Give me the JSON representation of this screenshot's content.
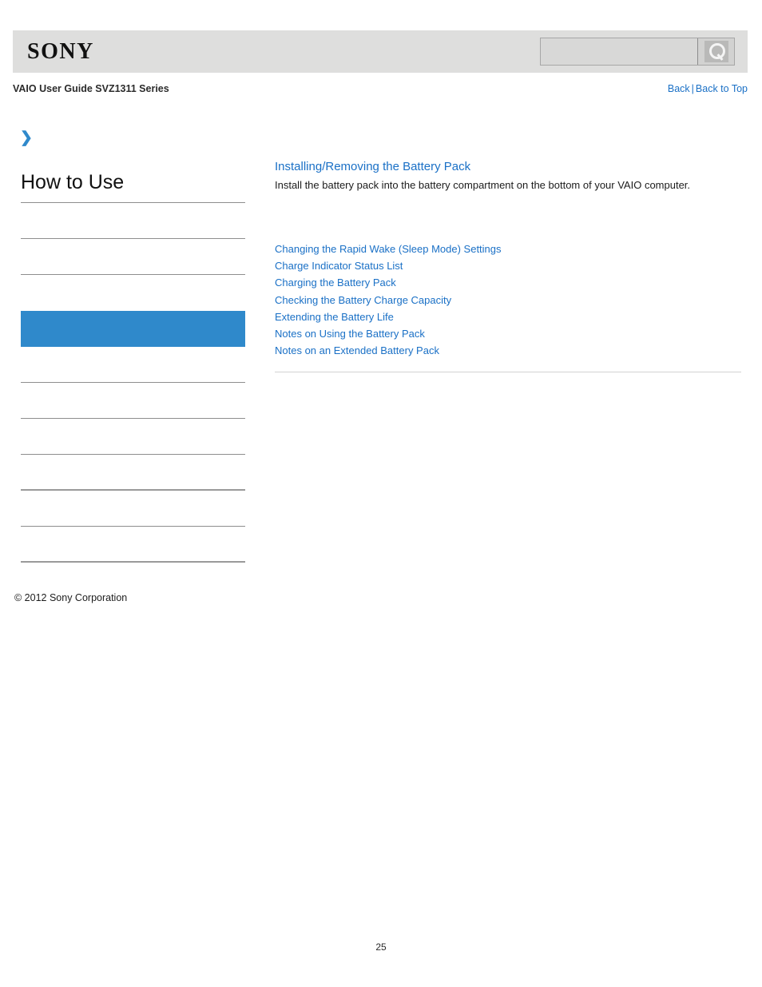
{
  "header": {
    "logo_text": "SONY",
    "search": {
      "value": "",
      "placeholder": "",
      "button_icon": "search-icon"
    }
  },
  "breadcrumb": {
    "title": "VAIO User Guide SVZ1311 Series",
    "back_label": "Back",
    "separator": "|",
    "back_to_top_label": "Back to Top"
  },
  "sidebar": {
    "chevron_icon": "chevron-right-icon",
    "title": "How to Use",
    "items": [
      {
        "label": "",
        "active": false,
        "thick": false
      },
      {
        "label": "",
        "active": false,
        "thick": false
      },
      {
        "label": "",
        "active": false,
        "thick": false
      },
      {
        "label": "",
        "active": true,
        "thick": false
      },
      {
        "label": "",
        "active": false,
        "thick": false
      },
      {
        "label": "",
        "active": false,
        "thick": false
      },
      {
        "label": "",
        "active": false,
        "thick": true
      },
      {
        "label": "",
        "active": false,
        "thick": false
      },
      {
        "label": "",
        "active": false,
        "thick": true
      }
    ],
    "copyright": "© 2012 Sony Corporation"
  },
  "main": {
    "heading": "Installing/Removing the Battery Pack",
    "description": "Install the battery pack into the battery compartment on the bottom of your VAIO computer.",
    "links": [
      "Changing the Rapid Wake (Sleep Mode) Settings",
      "Charge Indicator Status List",
      "Charging the Battery Pack",
      "Checking the Battery Charge Capacity",
      "Extending the Battery Life",
      "Notes on Using the Battery Pack",
      "Notes on an Extended Battery Pack"
    ]
  },
  "footer": {
    "page_number": "25"
  },
  "colors": {
    "link_blue": "#1a70c6",
    "accent_blue": "#2f89cb",
    "header_gray": "#dededd",
    "rule_gray": "#8e8e8e"
  }
}
